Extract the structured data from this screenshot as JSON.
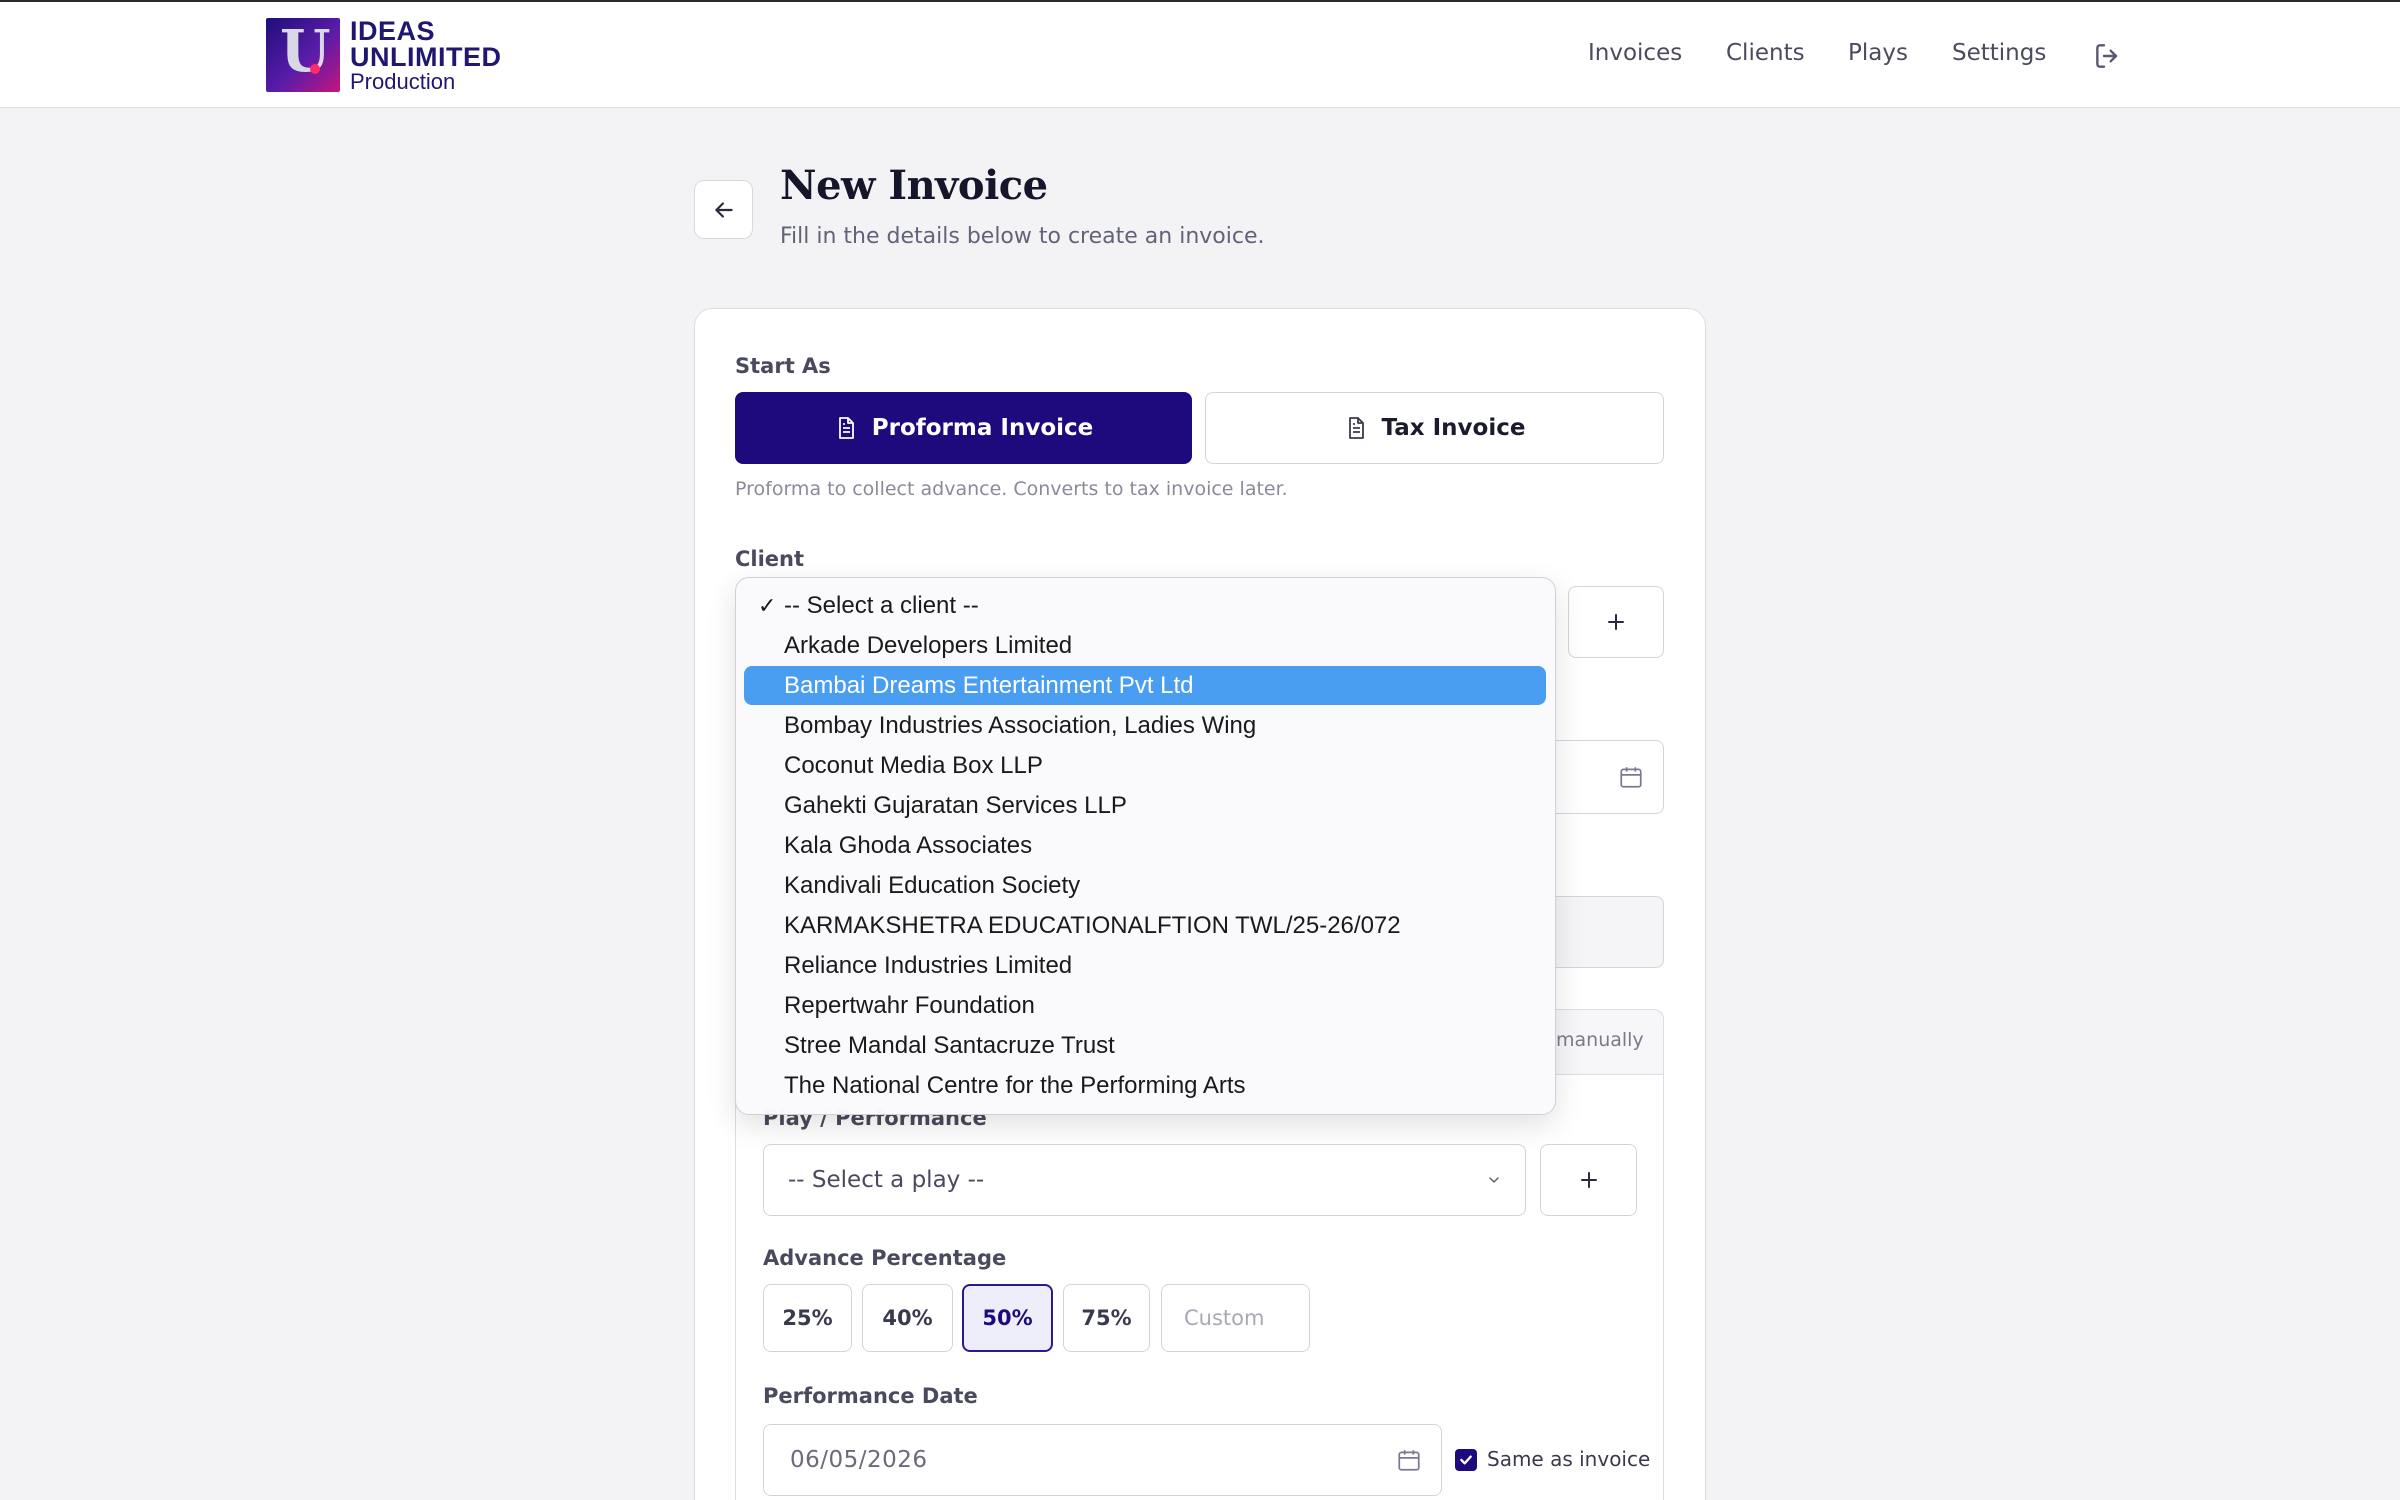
{
  "brand": {
    "line1": "IDEAS",
    "line2": "UNLIMITED",
    "line3": "Production"
  },
  "nav": {
    "items": [
      "Invoices",
      "Clients",
      "Plays",
      "Settings"
    ],
    "logout_icon": "logout-icon"
  },
  "header": {
    "title": "New Invoice",
    "subtitle": "Fill in the details below to create an invoice."
  },
  "form": {
    "start_as_label": "Start As",
    "proforma_label": "Proforma Invoice",
    "tax_label": "Tax Invoice",
    "type_hint": "Proforma to collect advance. Converts to tax invoice later.",
    "client_label": "Client",
    "manual_text": "manually",
    "play_label": "Play / Performance",
    "play_selected": "-- Select a play --",
    "advance_label": "Advance Percentage",
    "advance_options": [
      "25%",
      "40%",
      "50%",
      "75%"
    ],
    "advance_selected": "50%",
    "custom_placeholder": "Custom",
    "performance_date_label": "Performance Date",
    "performance_date_value": "06/05/2026",
    "same_as_invoice_label": "Same as invoice",
    "same_as_invoice_checked": true
  },
  "client_dropdown": {
    "selected": "-- Select a client --",
    "highlighted": "Bambai Dreams Entertainment Pvt Ltd",
    "options": [
      "-- Select a client --",
      "Arkade Developers Limited",
      "Bambai Dreams Entertainment Pvt Ltd",
      "Bombay Industries Association, Ladies Wing",
      "Coconut Media Box LLP",
      "Gahekti Gujaratan Services LLP",
      "Kala Ghoda Associates",
      "Kandivali Education Society",
      "KARMAKSHETRA EDUCATIONALFTION TWL/25-26/072",
      "Reliance Industries Limited",
      "Repertwahr Foundation",
      "Stree Mandal Santacruze Trust",
      "The National Centre for the Performing Arts"
    ]
  },
  "colors": {
    "primary": "#1e0a7c",
    "highlight": "#4a9ef2",
    "background": "#f3f3f5"
  }
}
